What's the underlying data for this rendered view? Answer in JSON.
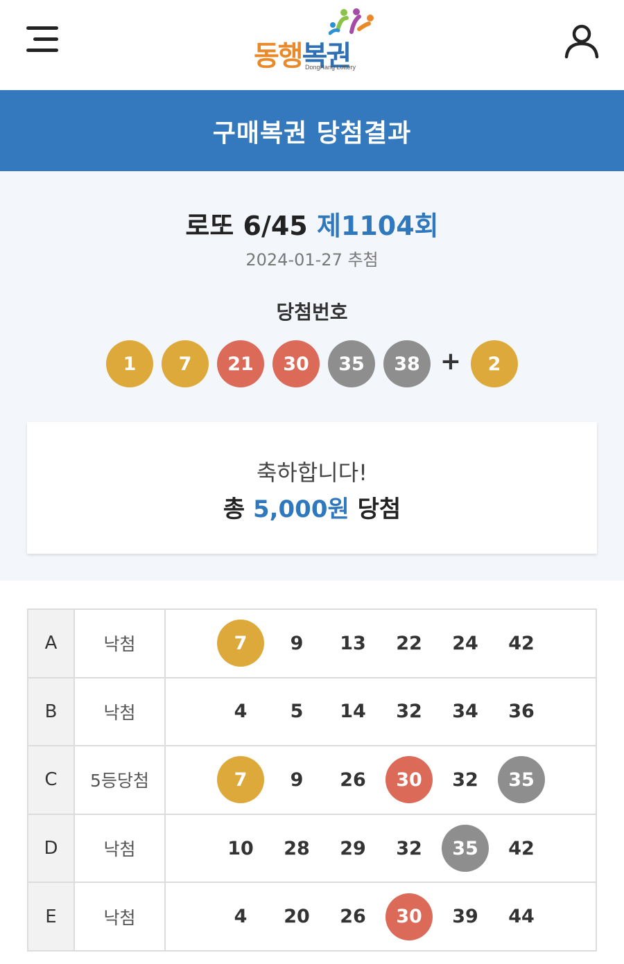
{
  "header": {
    "menu_icon": "hamburger-menu-icon",
    "logo": {
      "text_part1": "동행",
      "text_part2": "복권",
      "subtitle": "DongHang Lottery"
    },
    "user_icon": "user-icon"
  },
  "titlebar": {
    "title": "구매복권 당첨결과"
  },
  "result": {
    "game_name": "로또 6/45",
    "round": "제1104회",
    "draw_date": "2024-01-27 추첨",
    "win_label": "당첨번호",
    "winning_numbers": [
      "1",
      "7",
      "21",
      "30",
      "35",
      "38"
    ],
    "plus": "+",
    "bonus_number": "2"
  },
  "summary": {
    "congrats": "축하합니다!",
    "total_prefix": "총",
    "total_amount": "5,000원",
    "total_suffix": "당첨"
  },
  "tickets": [
    {
      "game": "A",
      "status": "낙첨",
      "numbers": [
        "7",
        "9",
        "13",
        "22",
        "24",
        "42"
      ],
      "hits": [
        true,
        false,
        false,
        false,
        false,
        false
      ]
    },
    {
      "game": "B",
      "status": "낙첨",
      "numbers": [
        "4",
        "5",
        "14",
        "32",
        "34",
        "36"
      ],
      "hits": [
        false,
        false,
        false,
        false,
        false,
        false
      ]
    },
    {
      "game": "C",
      "status": "5등당첨",
      "numbers": [
        "7",
        "9",
        "26",
        "30",
        "32",
        "35"
      ],
      "hits": [
        true,
        false,
        false,
        true,
        false,
        true
      ]
    },
    {
      "game": "D",
      "status": "낙첨",
      "numbers": [
        "10",
        "28",
        "29",
        "32",
        "35",
        "42"
      ],
      "hits": [
        false,
        false,
        false,
        false,
        true,
        false
      ]
    },
    {
      "game": "E",
      "status": "낙첨",
      "numbers": [
        "4",
        "20",
        "26",
        "30",
        "39",
        "44"
      ],
      "hits": [
        false,
        false,
        false,
        true,
        false,
        false
      ]
    }
  ],
  "colors": {
    "primary_blue": "#3478bd",
    "ball_yellow": "#dda93a",
    "ball_red": "#dc6a58",
    "ball_gray": "#8e8e8e",
    "ball_blue": "#5a8fd0",
    "ball_green": "#86c063"
  }
}
